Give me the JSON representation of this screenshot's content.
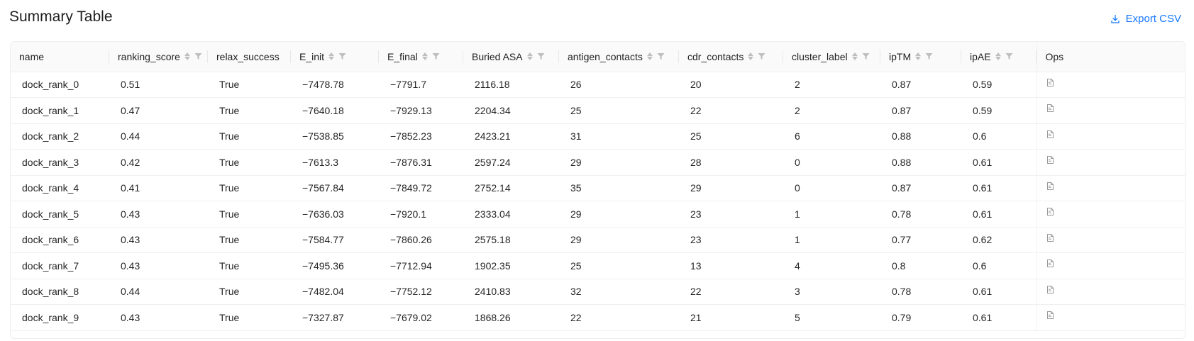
{
  "header": {
    "title": "Summary Table",
    "export_label": "Export CSV"
  },
  "table": {
    "columns": [
      {
        "key": "name",
        "label": "name",
        "sortable": false,
        "filterable": false
      },
      {
        "key": "ranking_score",
        "label": "ranking_score",
        "sortable": true,
        "filterable": true
      },
      {
        "key": "relax_success",
        "label": "relax_success",
        "sortable": false,
        "filterable": false
      },
      {
        "key": "E_init",
        "label": "E_init",
        "sortable": true,
        "filterable": true
      },
      {
        "key": "E_final",
        "label": "E_final",
        "sortable": true,
        "filterable": true
      },
      {
        "key": "buried_asa",
        "label": "Buried ASA",
        "sortable": true,
        "filterable": true
      },
      {
        "key": "antigen_contacts",
        "label": "antigen_contacts",
        "sortable": true,
        "filterable": true
      },
      {
        "key": "cdr_contacts",
        "label": "cdr_contacts",
        "sortable": true,
        "filterable": true
      },
      {
        "key": "cluster_label",
        "label": "cluster_label",
        "sortable": true,
        "filterable": true
      },
      {
        "key": "ipTM",
        "label": "ipTM",
        "sortable": true,
        "filterable": true
      },
      {
        "key": "ipAE",
        "label": "ipAE",
        "sortable": true,
        "filterable": true
      },
      {
        "key": "ops",
        "label": "Ops",
        "sortable": false,
        "filterable": false
      }
    ],
    "rows": [
      [
        "dock_rank_0",
        "0.51",
        "True",
        "−7478.78",
        "−7791.7",
        "2116.18",
        "26",
        "20",
        "2",
        "0.87",
        "0.59"
      ],
      [
        "dock_rank_1",
        "0.47",
        "True",
        "−7640.18",
        "−7929.13",
        "2204.34",
        "25",
        "22",
        "2",
        "0.87",
        "0.59"
      ],
      [
        "dock_rank_2",
        "0.44",
        "True",
        "−7538.85",
        "−7852.23",
        "2423.21",
        "31",
        "25",
        "6",
        "0.88",
        "0.6"
      ],
      [
        "dock_rank_3",
        "0.42",
        "True",
        "−7613.3",
        "−7876.31",
        "2597.24",
        "29",
        "28",
        "0",
        "0.88",
        "0.61"
      ],
      [
        "dock_rank_4",
        "0.41",
        "True",
        "−7567.84",
        "−7849.72",
        "2752.14",
        "35",
        "29",
        "0",
        "0.87",
        "0.61"
      ],
      [
        "dock_rank_5",
        "0.43",
        "True",
        "−7636.03",
        "−7920.1",
        "2333.04",
        "29",
        "23",
        "1",
        "0.78",
        "0.61"
      ],
      [
        "dock_rank_6",
        "0.43",
        "True",
        "−7584.77",
        "−7860.26",
        "2575.18",
        "29",
        "23",
        "1",
        "0.77",
        "0.62"
      ],
      [
        "dock_rank_7",
        "0.43",
        "True",
        "−7495.36",
        "−7712.94",
        "1902.35",
        "25",
        "13",
        "4",
        "0.8",
        "0.6"
      ],
      [
        "dock_rank_8",
        "0.44",
        "True",
        "−7482.04",
        "−7752.12",
        "2410.83",
        "32",
        "22",
        "3",
        "0.78",
        "0.61"
      ],
      [
        "dock_rank_9",
        "0.43",
        "True",
        "−7327.87",
        "−7679.02",
        "1868.26",
        "22",
        "21",
        "5",
        "0.79",
        "0.61"
      ]
    ],
    "row_action_icon": "document-icon"
  },
  "colors": {
    "accent": "#1677ff",
    "header_bg": "#fafafa",
    "border": "#f0f0f0",
    "icon_muted": "#bfbfbf"
  }
}
